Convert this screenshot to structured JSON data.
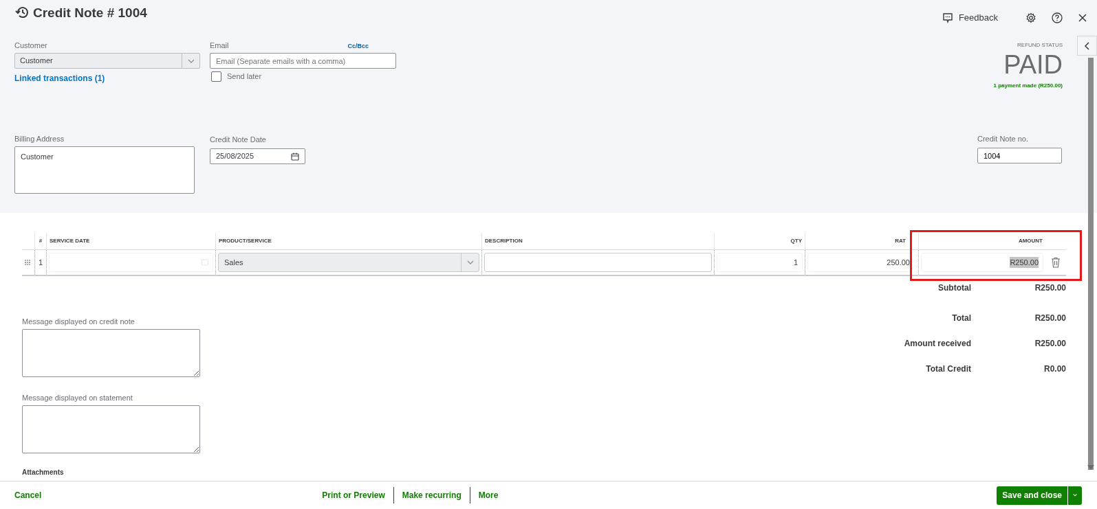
{
  "header": {
    "title": "Credit Note # 1004",
    "feedback": "Feedback"
  },
  "customer": {
    "label": "Customer",
    "value": "Customer",
    "link": "Linked transactions (1)"
  },
  "email": {
    "label": "Email",
    "cc_bcc": "Cc/Bcc",
    "placeholder": "Email (Separate emails with a comma)",
    "send_later": {
      "label": "Send later",
      "checked": false
    }
  },
  "refund_status": {
    "label": "REFUND STATUS",
    "status": "PAID",
    "note": "1 payment made (R250.00)"
  },
  "billing_address": {
    "label": "Billing Address",
    "value": "Customer"
  },
  "credit_note_date": {
    "label": "Credit Note Date",
    "value": "25/08/2025"
  },
  "credit_note_no": {
    "label": "Credit Note no.",
    "value": "1004"
  },
  "table": {
    "columns": [
      {
        "label": "#"
      },
      {
        "label": "SERVICE DATE"
      },
      {
        "label": "PRODUCT/SERVICE"
      },
      {
        "label": "DESCRIPTION"
      },
      {
        "label": "QTY"
      },
      {
        "label": "RAT"
      },
      {
        "label": "AMOUNT",
        "highlighted": true
      }
    ],
    "rows": [
      {
        "number": "1",
        "product": "Sales",
        "qty": "1",
        "rate": "250.00",
        "amount": "R250.00",
        "amount_selected": true
      }
    ]
  },
  "totals": [
    {
      "label": "Subtotal",
      "value": "R250.00"
    },
    {
      "label": "Total",
      "value": "R250.00"
    },
    {
      "label": "Amount received",
      "value": "R250.00"
    },
    {
      "label": "Total Credit",
      "value": "R0.00"
    }
  ],
  "messages": [
    {
      "label": "Message displayed on credit note"
    },
    {
      "label": "Message displayed on statement"
    }
  ],
  "attachments": {
    "label": "Attachments"
  },
  "footer": {
    "cancel": "Cancel",
    "actions": [
      "Print or Preview",
      "Make recurring",
      "More"
    ],
    "primary": "Save and close"
  }
}
